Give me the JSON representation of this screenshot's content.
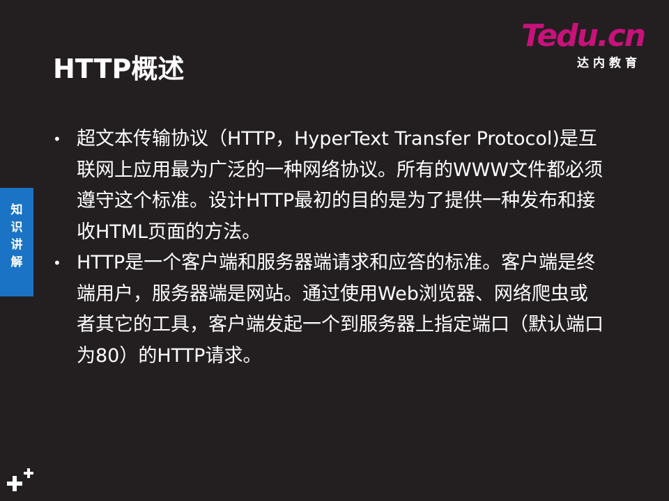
{
  "slide": {
    "title": "HTTP概述",
    "logo": {
      "mark": "Tedu.cn",
      "subtitle": "达内教育",
      "colors": {
        "mark": "#c8127a",
        "subtitle": "#ffffff"
      }
    },
    "side_tab": {
      "label": "知识讲解",
      "color": "#1a73c4"
    },
    "bullets": [
      {
        "text": "超文本传输协议（HTTP，HyperText Transfer Protocol)是互联网上应用最为广泛的一种网络协议。所有的WWW文件都必须遵守这个标准。设计HTTP最初的目的是为了提供一种发布和接收HTML页面的方法。"
      },
      {
        "text": "HTTP是一个客户端和服务器端请求和应答的标准。客户端是终端用户，服务器端是网站。通过使用Web浏览器、网络爬虫或者其它的工具，客户端发起一个到服务器上指定端口（默认端口为80）的HTTP请求。"
      }
    ],
    "bullet_marker": "•",
    "corner_icon": "plus-cluster-icon",
    "background_color": "#231f20"
  }
}
